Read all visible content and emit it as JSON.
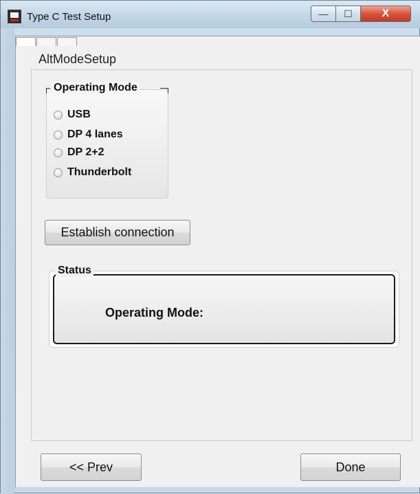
{
  "window": {
    "title": "Type C Test Setup",
    "buttons": {
      "minimize": "—",
      "maximize": "☐",
      "close": "X"
    }
  },
  "tab_page": {
    "label": "AltModeSetup"
  },
  "operating_mode_group": {
    "title": "Operating Mode",
    "options": [
      "USB",
      "DP 4 lanes",
      "DP 2+2",
      "Thunderbolt"
    ]
  },
  "establish_button": {
    "label": "Establish connection"
  },
  "status_group": {
    "title": "Status",
    "operating_mode_label": "Operating Mode:"
  },
  "nav": {
    "prev_label": "<< Prev",
    "done_label": "Done"
  }
}
